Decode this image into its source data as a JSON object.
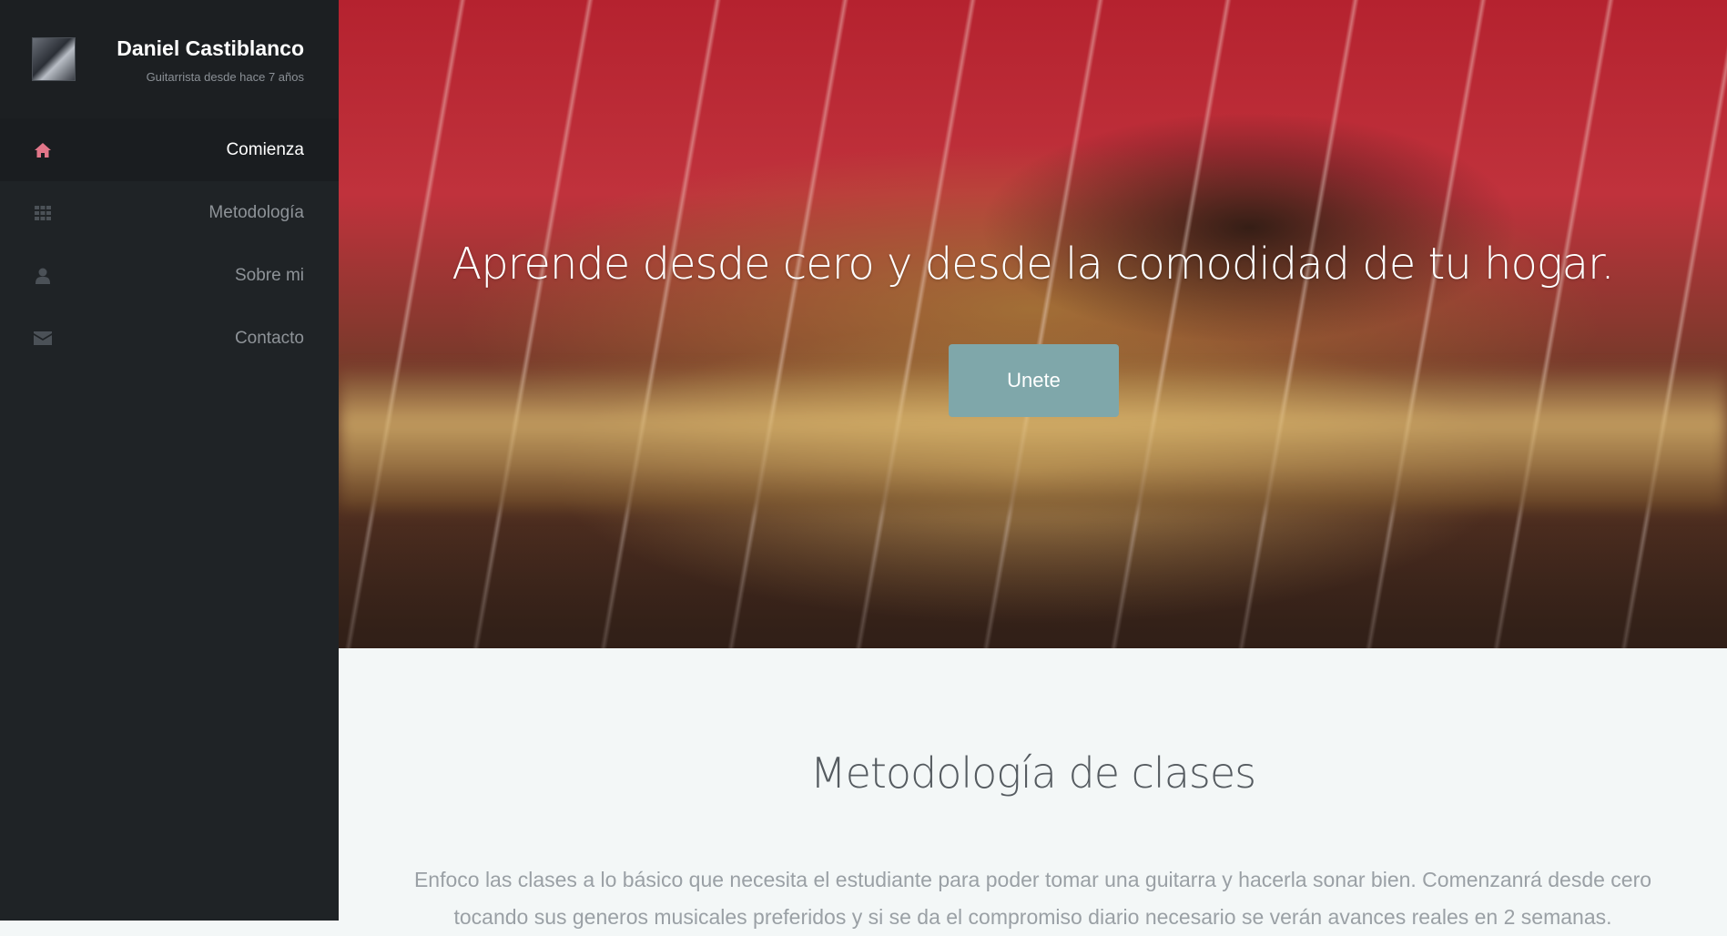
{
  "profile": {
    "name": "Daniel Castiblanco",
    "subtitle": "Guitarrista desde hace 7 años"
  },
  "nav": {
    "items": [
      {
        "label": "Comienza",
        "icon": "home-icon",
        "active": true
      },
      {
        "label": "Metodología",
        "icon": "grid-icon",
        "active": false
      },
      {
        "label": "Sobre mi",
        "icon": "user-icon",
        "active": false
      },
      {
        "label": "Contacto",
        "icon": "envelope-icon",
        "active": false
      }
    ]
  },
  "hero": {
    "title": "Aprende desde cero y desde la comodidad de tu hogar.",
    "button_label": "Unete"
  },
  "methodology": {
    "title": "Metodología de clases",
    "text": "Enfoco las clases a lo básico que necesita el estudiante para poder tomar una guitarra y hacerla sonar bien. Comenzanrá desde cero tocando sus generos musicales preferidos y si se da el compromiso diario necesario se verán avances reales en 2 semanas."
  },
  "colors": {
    "sidebar_bg": "#1f2326",
    "active_icon": "#e27689",
    "button_bg": "#7fa7aa",
    "section_bg": "#f3f7f7"
  }
}
